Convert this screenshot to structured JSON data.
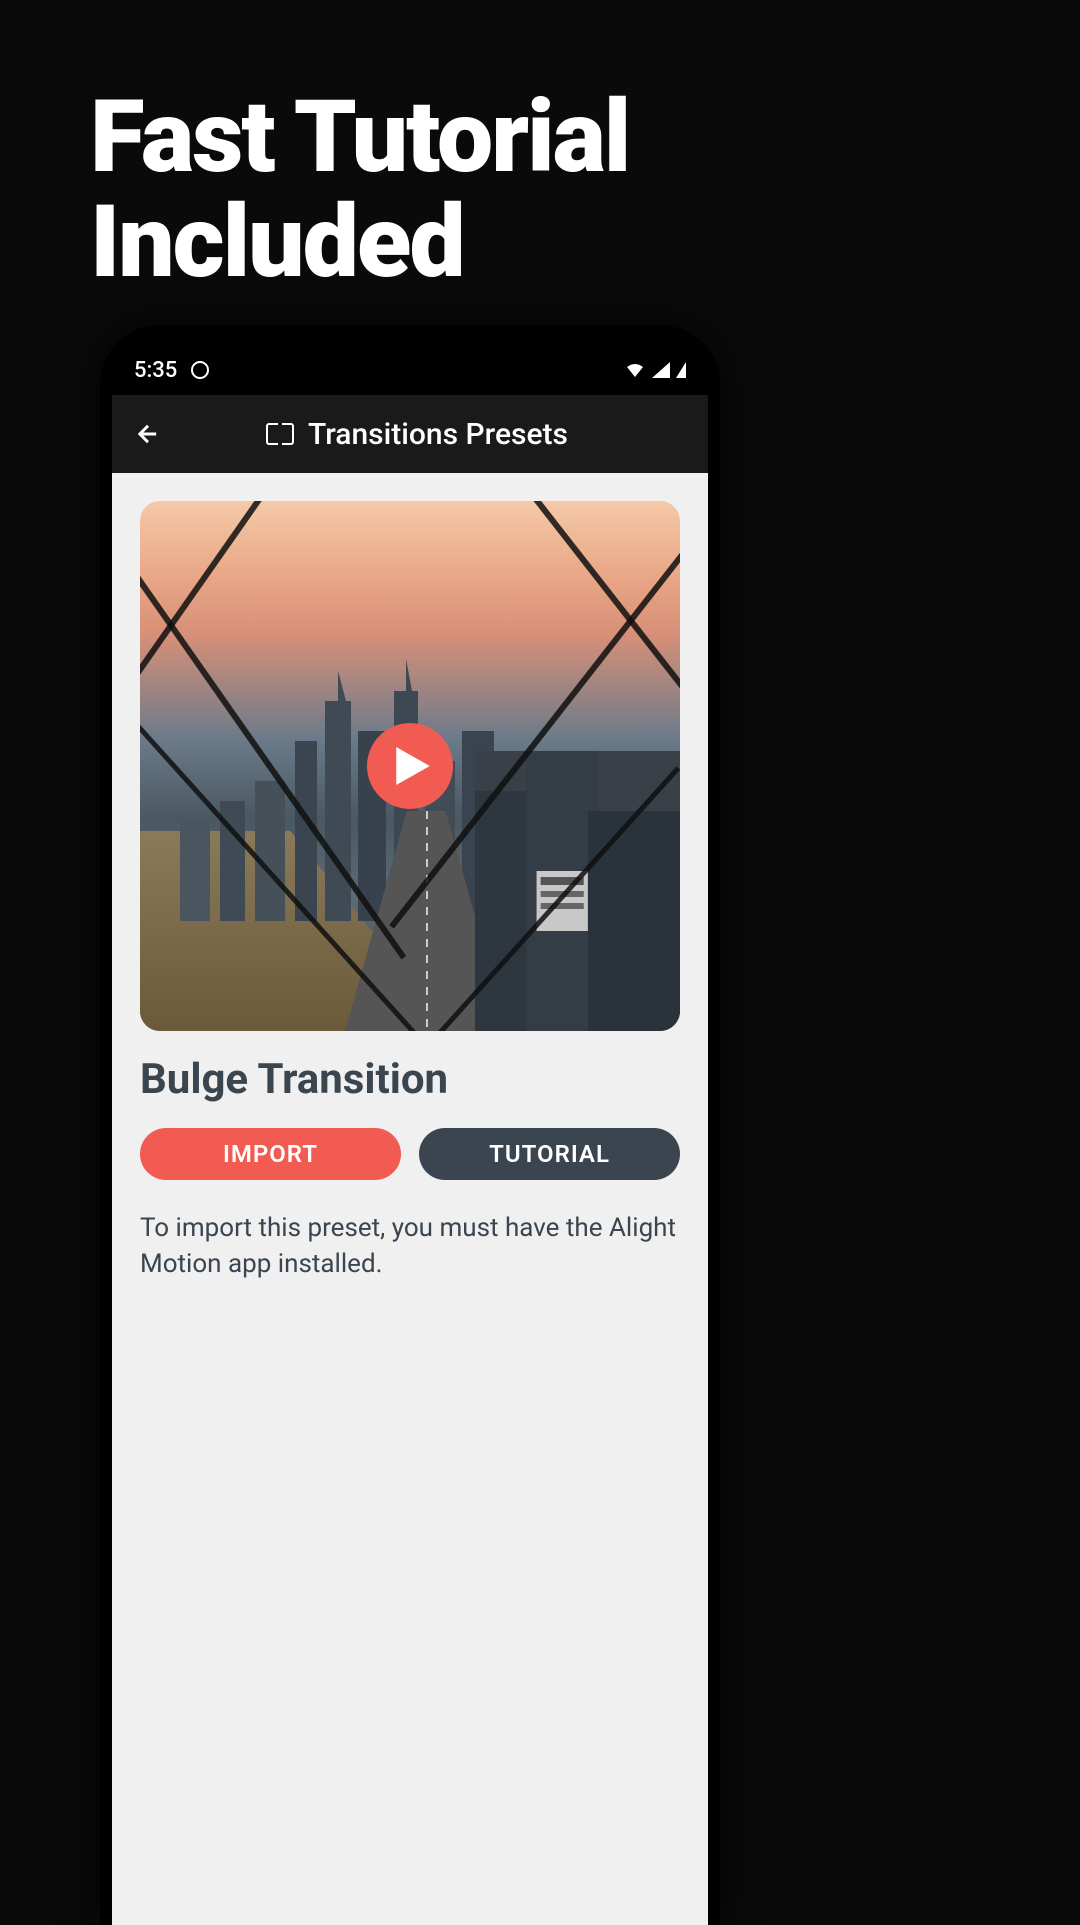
{
  "promo": {
    "heading_line1": "Fast Tutorial",
    "heading_line2": "Included"
  },
  "status_bar": {
    "time": "5:35"
  },
  "app_bar": {
    "title": "Transitions Presets"
  },
  "preset": {
    "title": "Bulge Transition",
    "import_label": "IMPORT",
    "tutorial_label": "TUTORIAL",
    "info_text": "To import this preset, you must have the Alight Motion app installed."
  }
}
